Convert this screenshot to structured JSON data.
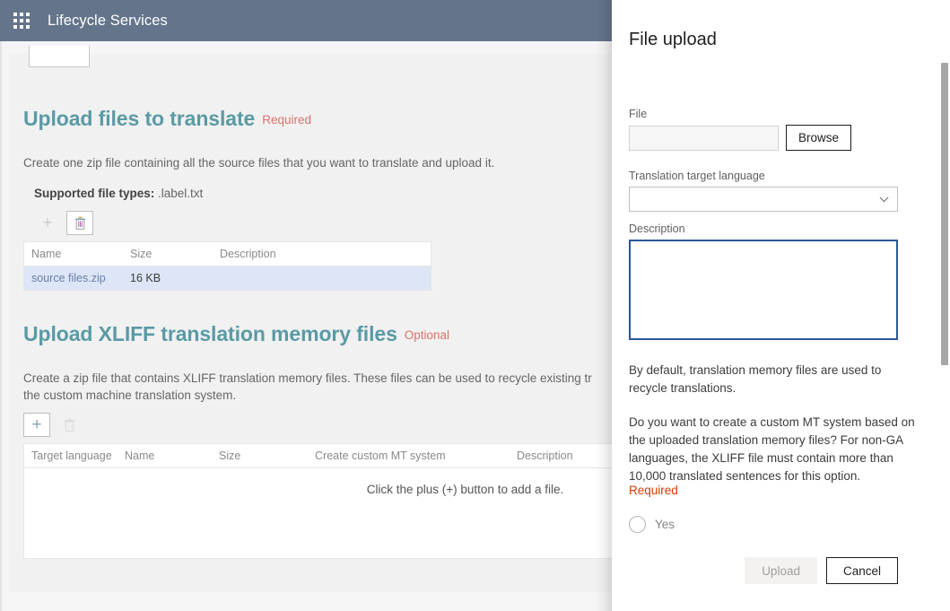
{
  "topbar": {
    "waffle_icon": "app-launcher-grid-icon",
    "app_title": "Lifecycle Services"
  },
  "sections": [
    {
      "title": "Upload files to translate",
      "tag": "Required",
      "description": "Create one zip file containing all the source files that you want to translate and upload it.",
      "supported_label": "Supported file types:",
      "supported_value": ".label.txt",
      "toolbar": {
        "add_label": "+",
        "delete_label": "delete"
      },
      "columns": [
        "Name",
        "Size",
        "Description"
      ],
      "rows": [
        {
          "name": "source files.zip",
          "size": "16 KB",
          "description": ""
        }
      ]
    },
    {
      "title": "Upload XLIFF translation memory files",
      "tag": "Optional",
      "description_line1": "Create a zip file that contains XLIFF translation memory files. These files can be used to recycle existing tr",
      "description_line2": "the custom machine translation system.",
      "toolbar": {
        "add_label": "+",
        "delete_label": "delete"
      },
      "columns": [
        "Target language",
        "Name",
        "Size",
        "Create custom MT system",
        "Description"
      ],
      "empty_message": "Click the plus (+) button to add a file."
    }
  ],
  "panel": {
    "title": "File upload",
    "file_label": "File",
    "file_value": "",
    "file_placeholder": "",
    "browse_label": "Browse",
    "language_label": "Translation target language",
    "language_value": "",
    "chevron_icon": "chevron-down-icon",
    "description_label": "Description",
    "description_value": "",
    "para1": "By default, translation memory files are used to recycle translations.",
    "para2": "Do you want to create a custom MT system based on the uploaded translation memory files? For non-GA languages, the XLIFF file must contain more than 10,000 translated sentences for this option.",
    "required_text": "Required",
    "radio_label": "Yes",
    "upload_label": "Upload",
    "cancel_label": "Cancel"
  },
  "colors": {
    "topbar": "#64748b",
    "heading_teal": "#5a9aa5",
    "tag_red": "#d9736b",
    "required_orange": "#d83b01",
    "focus_blue": "#2b579a",
    "row_selected": "#dce6f6",
    "link_blue": "#6a7fa8"
  }
}
